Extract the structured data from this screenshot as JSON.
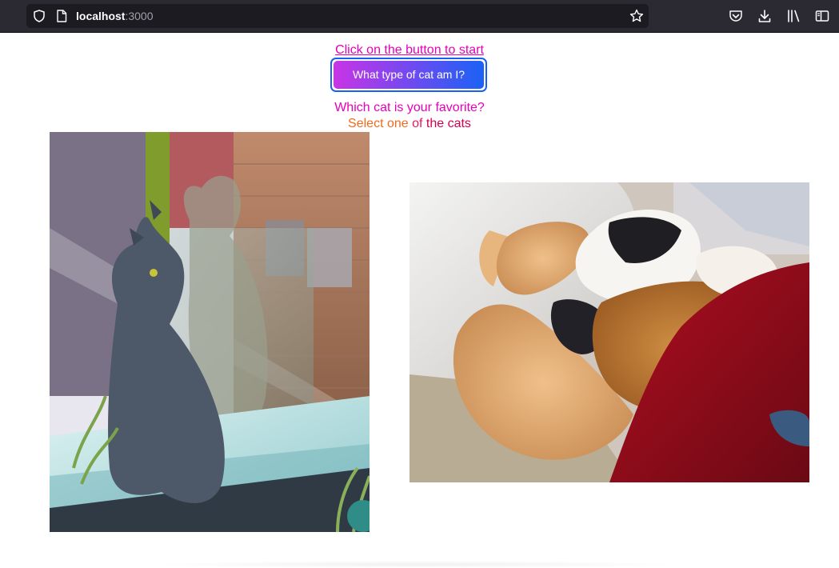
{
  "browser": {
    "url_host": "localhost",
    "url_port": ":3000",
    "icons": [
      "shield-icon",
      "page-icon",
      "bookmark-star-icon",
      "pocket-icon",
      "download-icon",
      "library-icon",
      "sidebar-icon"
    ]
  },
  "page": {
    "intro_text": "Click on the button to start",
    "cta_label": "What type of cat am I?",
    "question": "Which cat is your favorite?",
    "select": {
      "part1": "Select one",
      "part2": " of",
      "part3": " the cats"
    }
  },
  "cats": [
    {
      "name": "sphynx-cat-photo"
    },
    {
      "name": "sleeping-cats-photo"
    }
  ],
  "colors": {
    "accent_pink": "#e600b8",
    "button_gradient_start": "#c934e6",
    "button_gradient_end": "#1a62f5",
    "button_focus_ring": "#1861f0",
    "orange_text": "#f36a1c",
    "red_text": "#d1004f"
  }
}
